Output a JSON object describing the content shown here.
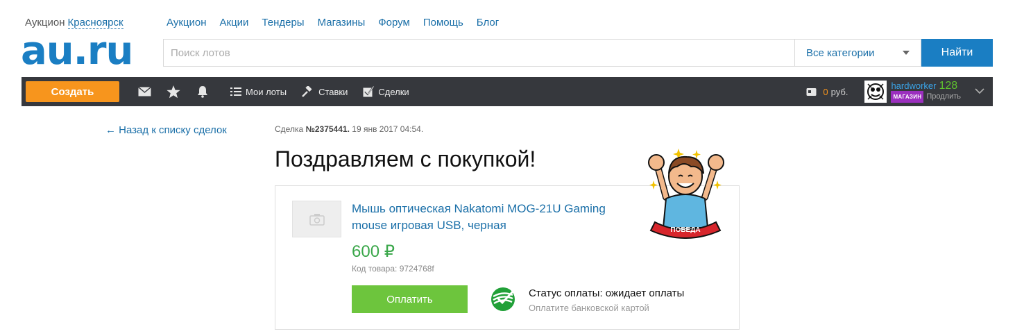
{
  "header": {
    "city_prefix": "Аукцион",
    "city": "Красноярск",
    "logo": "au.ru",
    "nav": [
      "Аукцион",
      "Акции",
      "Тендеры",
      "Магазины",
      "Форум",
      "Помощь",
      "Блог"
    ],
    "search_placeholder": "Поиск лотов",
    "category": "Все категории",
    "find_label": "Найти"
  },
  "toolbar": {
    "create_label": "Создать",
    "my_lots": "Мои лоты",
    "bids": "Ставки",
    "deals": "Сделки",
    "balance": "0",
    "currency": "руб.",
    "username": "hardworker",
    "score": "128",
    "shop_badge": "МАГАЗИН",
    "extend": "Продлить"
  },
  "deal": {
    "back_label": "← Назад к списку сделок",
    "meta_prefix": "Сделка",
    "number": "№2375441.",
    "date": "19 янв 2017 04:54.",
    "title": "Поздравляем с покупкой!",
    "winner_ribbon": "ПОБЕДА"
  },
  "product": {
    "title": "Мышь оптическая Nakatomi MOG-21U Gaming mouse игровая USB, черная",
    "price": "600 ₽",
    "code": "Код товара: 9724768f",
    "pay_label": "Оплатить",
    "pay_status": "Статус оплаты: ожидает оплаты",
    "pay_hint": "Оплатите банковской картой"
  },
  "colors": {
    "brand": "#1a7ec3",
    "toolbar_bg": "#36383d",
    "create": "#f7951d",
    "pay": "#6dc53d",
    "price": "#3aa74a"
  }
}
